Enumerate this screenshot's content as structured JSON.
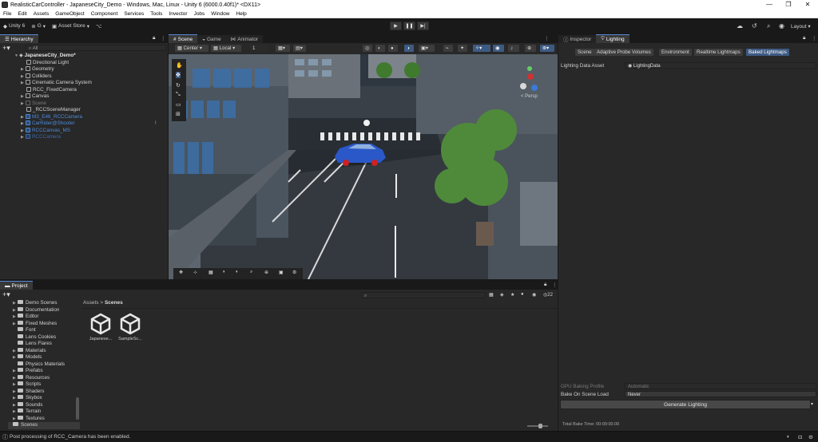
{
  "window": {
    "title": "RealisticCarController - JapaneseCity_Demo - Windows, Mac, Linux - Unity 6 (6000.0.40f1)* <DX11>"
  },
  "menu": [
    "File",
    "Edit",
    "Assets",
    "GameObject",
    "Component",
    "Services",
    "Tools",
    "Invector",
    "Jobs",
    "Window",
    "Help"
  ],
  "toolbar": {
    "unity_label": "Unity 6",
    "account_label": "G",
    "asset_store_label": "Asset Store",
    "layout_label": "Layout"
  },
  "hierarchy": {
    "tab_label": "Hierarchy",
    "search_placeholder": "All",
    "scene_name": "JapaneseCity_Demo*",
    "items": [
      {
        "label": "Directional Light"
      },
      {
        "label": "Geometry"
      },
      {
        "label": "Colliders"
      },
      {
        "label": "Cinematic Camera System"
      },
      {
        "label": "RCC_FixedCamera"
      },
      {
        "label": "Canvas"
      },
      {
        "label": "Scene"
      },
      {
        "label": "_RCCSceneManager"
      },
      {
        "label": "M3_E46_RCCCamera"
      },
      {
        "label": "CarRider@Shooter"
      },
      {
        "label": "RCCCanvas_MS"
      },
      {
        "label": "RCCCamera"
      }
    ]
  },
  "scene_view": {
    "tabs": [
      "Scene",
      "Game",
      "Animator"
    ],
    "pivot_label": "Center",
    "space_label": "Local",
    "snap_value": "1",
    "gizmo_label": "< Persp"
  },
  "inspector": {
    "tabs": [
      "Inspector",
      "Lighting"
    ],
    "lighting_tabs": [
      "Scene",
      "Adaptive Probe Volumes",
      "Environment",
      "Realtime Lightmaps",
      "Baked Lightmaps"
    ],
    "lighting_data_label": "Lighting Data Asset",
    "lighting_data_value": "LightingData",
    "gpu_profile_label": "GPU Baking Profile",
    "gpu_profile_value": "Automatic",
    "bake_on_load_label": "Bake On Scene Load",
    "bake_on_load_value": "Never",
    "generate_button": "Generate Lighting",
    "bake_time_label": "Total Bake Time: 00:00:00.00"
  },
  "project": {
    "tab_label": "Project",
    "folders": [
      "Demo Scenes",
      "Documentation",
      "Editor",
      "Fixed Meshes",
      "Font",
      "Lens Cookies",
      "Lens Flares",
      "Materials",
      "Models",
      "Physics Materials",
      "Prefabs",
      "Resources",
      "Scripts",
      "Shaders",
      "Skybox",
      "Sounds",
      "Terrain",
      "Textures",
      "Scenes"
    ],
    "breadcrumb": [
      "Assets",
      "Scenes"
    ],
    "assets": [
      {
        "label": "Japanese..."
      },
      {
        "label": "SampleSc..."
      }
    ],
    "count": "22"
  },
  "status": {
    "message": "Post processing of RCC_Camera has been enabled."
  },
  "colors": {
    "accent": "#3d5a82",
    "selection_blue": "#4d8bdc"
  }
}
